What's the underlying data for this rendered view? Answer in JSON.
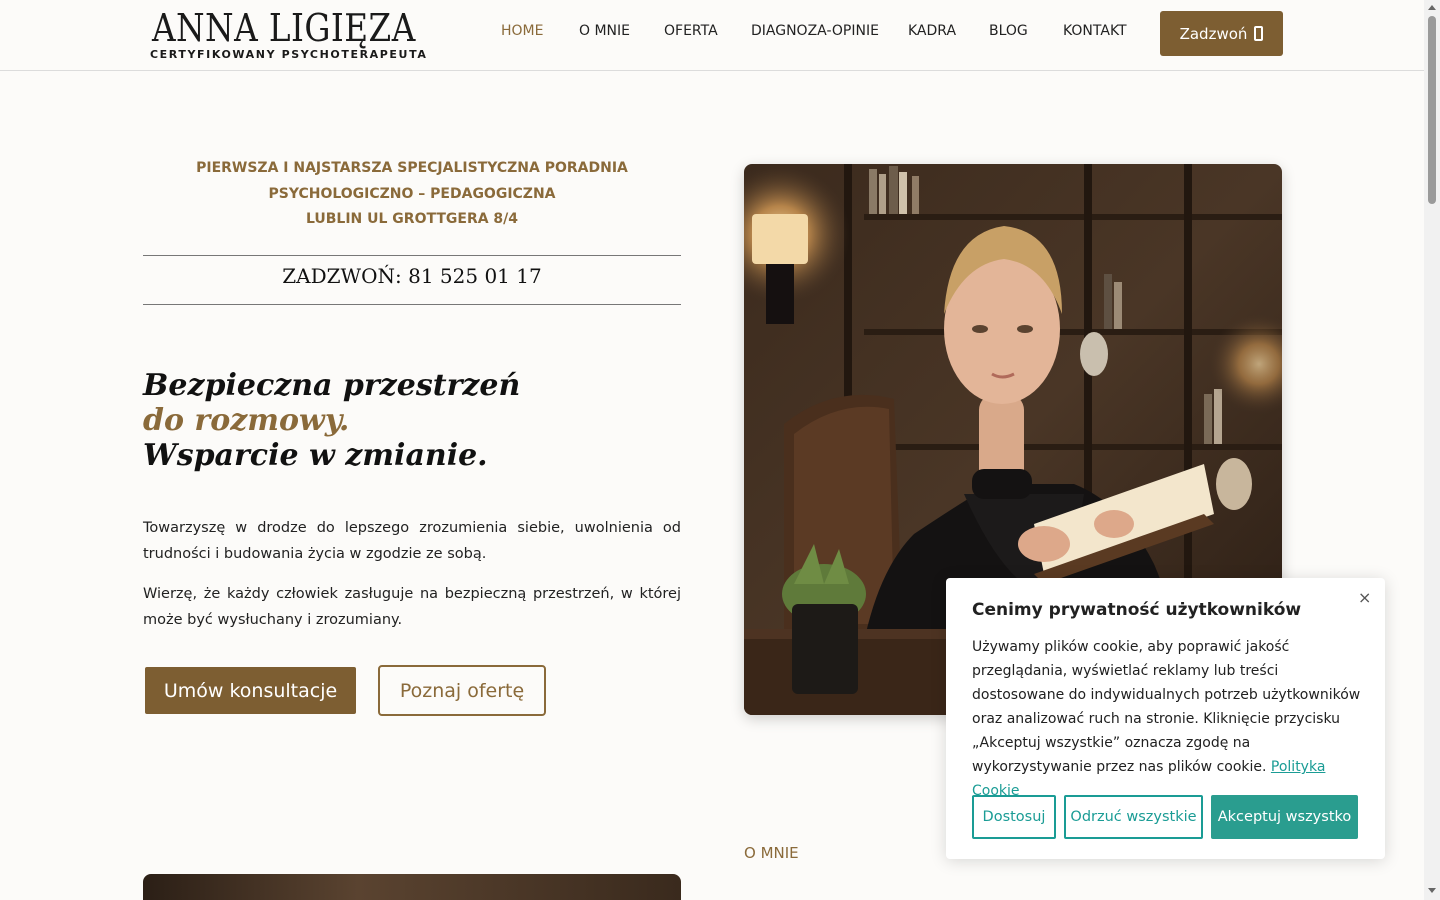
{
  "header": {
    "logo_name": "ANNA LIGIĘZA",
    "logo_subtitle": "CERTYFIKOWANY PSYCHOTERAPEUTA",
    "nav": [
      {
        "label": "HOME",
        "active": true
      },
      {
        "label": "O MNIE"
      },
      {
        "label": "OFERTA"
      },
      {
        "label": "DIAGNOZA-OPINIE"
      },
      {
        "label": "KADRA"
      },
      {
        "label": "BLOG"
      },
      {
        "label": "KONTAKT"
      }
    ],
    "call_button": "Zadzwoń",
    "call_icon": "phone-icon"
  },
  "hero": {
    "tagline_line1": "PIERWSZA I NAJSTARSZA SPECJALISTYCZNA PORADNIA",
    "tagline_line2": "PSYCHOLOGICZNO – PEDAGOGICZNA",
    "tagline_line3": "LUBLIN UL GROTTGERA 8/4",
    "phone_line": "ZADZWOŃ: 81 525 01 17",
    "headline_line1": "Bezpieczna przestrzeń",
    "headline_line2": "do rozmowy.",
    "headline_line3": "Wsparcie w zmianie.",
    "paragraph1": "Towarzyszę w drodze do lepszego zrozumienia siebie, uwolnienia od trudności i budowania życia w zgodzie ze sobą.",
    "paragraph2": "Wierzę, że każdy człowiek zasługuje na bezpieczną przestrzeń, w której może być wysłuchany i zrozumiany.",
    "primary_button": "Umów konsultacje",
    "secondary_button": "Poznaj ofertę"
  },
  "about": {
    "section_label": "O MNIE"
  },
  "cookie": {
    "title": "Cenimy prywatność użytkowników",
    "close_icon": "×",
    "text": "Używamy plików cookie, aby poprawić jakość przeglądania, wyświetlać reklamy lub treści dostosowane do indywidualnych potrzeb użytkowników oraz analizować ruch na stronie. Kliknięcie przycisku „Akceptuj wszystkie” oznacza zgodę na wykorzystywanie przez nas plików cookie.",
    "link": "Polityka Cookie",
    "btn_customize": "Dostosuj",
    "btn_reject": "Odrzuć wszystkie",
    "btn_accept": "Akceptuj wszystko"
  },
  "colors": {
    "accent_gold": "#7d5e32",
    "cookie_teal": "#2a9d8f"
  }
}
